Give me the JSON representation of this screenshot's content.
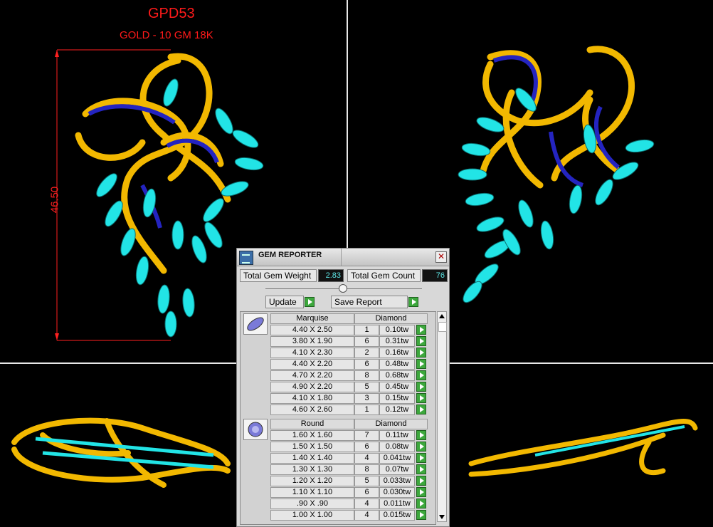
{
  "design": {
    "code": "GPD53",
    "metal": "GOLD - 10 GM 18K",
    "dimension": "46.50"
  },
  "colors": {
    "gold": "#f2b800",
    "turquoise": "#22e4e6",
    "sapphire": "#2020c8",
    "dimension_red": "#ff1a1a"
  },
  "panel": {
    "title": "GEM REPORTER",
    "close_icon": "close-icon",
    "total_weight_label": "Total Gem Weight",
    "total_weight_value": "2.83",
    "total_count_label": "Total Gem Count",
    "total_count_value": "76",
    "update_label": "Update",
    "save_label": "Save Report",
    "groups": [
      {
        "shape": "Marquise",
        "material": "Diamond",
        "rows": [
          {
            "size": "4.40 X 2.50",
            "count": "1",
            "weight": "0.10tw"
          },
          {
            "size": "3.80 X 1.90",
            "count": "6",
            "weight": "0.31tw"
          },
          {
            "size": "4.10 X 2.30",
            "count": "2",
            "weight": "0.16tw"
          },
          {
            "size": "4.40 X 2.20",
            "count": "6",
            "weight": "0.48tw"
          },
          {
            "size": "4.70 X 2.20",
            "count": "8",
            "weight": "0.68tw"
          },
          {
            "size": "4.90 X 2.20",
            "count": "5",
            "weight": "0.45tw"
          },
          {
            "size": "4.10 X 1.80",
            "count": "3",
            "weight": "0.15tw"
          },
          {
            "size": "4.60 X 2.60",
            "count": "1",
            "weight": "0.12tw"
          }
        ]
      },
      {
        "shape": "Round",
        "material": "Diamond",
        "rows": [
          {
            "size": "1.60 X 1.60",
            "count": "7",
            "weight": "0.11tw"
          },
          {
            "size": "1.50 X 1.50",
            "count": "6",
            "weight": "0.08tw"
          },
          {
            "size": "1.40 X 1.40",
            "count": "4",
            "weight": "0.041tw"
          },
          {
            "size": "1.30 X 1.30",
            "count": "8",
            "weight": "0.07tw"
          },
          {
            "size": "1.20 X 1.20",
            "count": "5",
            "weight": "0.033tw"
          },
          {
            "size": "1.10 X 1.10",
            "count": "6",
            "weight": "0.030tw"
          },
          {
            "size": ".90 X .90",
            "count": "4",
            "weight": "0.011tw"
          },
          {
            "size": "1.00 X 1.00",
            "count": "4",
            "weight": "0.015tw"
          }
        ]
      }
    ]
  }
}
